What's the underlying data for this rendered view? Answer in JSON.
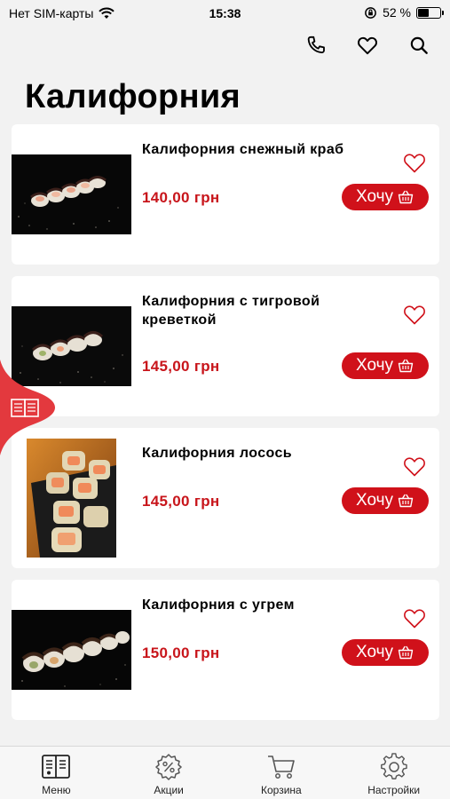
{
  "status": {
    "carrier": "Нет SIM-карты",
    "time": "15:38",
    "battery": "52 %",
    "battery_level": 0.52
  },
  "page_title": "Калифорния",
  "products": [
    {
      "name": "Калифорния снежный краб",
      "price": "140,00 грн",
      "button": "Хочу"
    },
    {
      "name": "Калифорния с тигровой креветкой",
      "price": "145,00 грн",
      "button": "Хочу"
    },
    {
      "name": "Калифорния лосось",
      "price": "145,00 грн",
      "button": "Хочу"
    },
    {
      "name": "Калифорния с угрем",
      "price": "150,00 грн",
      "button": "Хочу"
    }
  ],
  "tabs": [
    {
      "label": "Меню",
      "icon": "menu-book-icon",
      "active": true
    },
    {
      "label": "Акции",
      "icon": "discount-icon"
    },
    {
      "label": "Корзина",
      "icon": "cart-icon"
    },
    {
      "label": "Настройки",
      "icon": "gear-icon"
    }
  ],
  "colors": {
    "accent": "#d0111a",
    "price": "#c8151b",
    "background": "#f2f2f2"
  }
}
